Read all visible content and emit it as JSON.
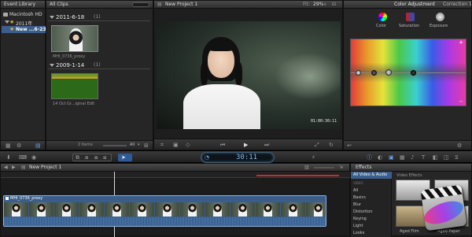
{
  "event_library": {
    "title": "Event Library",
    "items": [
      {
        "label": "Macintosh HD"
      },
      {
        "label": "2011年"
      },
      {
        "label": "New ...6-23"
      }
    ],
    "footer_count": ""
  },
  "browser": {
    "title": "All Clips",
    "groups": [
      {
        "date": "2011-6-18",
        "count": "(1)",
        "clips": [
          {
            "name": "MHI_0736_proxy"
          }
        ]
      },
      {
        "date": "2009-1-14",
        "count": "(1)",
        "clips": [
          {
            "name": "14 Oct Gr...iginal Edit"
          }
        ]
      }
    ],
    "footer_items": "2 items",
    "footer_all": "All"
  },
  "viewer": {
    "title": "New Project 1",
    "fit_label": "Fit:",
    "fit_value": "29%",
    "timecode_overlay": "01:00:30:11"
  },
  "inspector": {
    "title": "Color Adjustment",
    "correction": "Correction 1",
    "tabs": [
      {
        "label": "Color"
      },
      {
        "label": "Saturation"
      },
      {
        "label": "Exposure"
      }
    ]
  },
  "toolbar": {
    "timecode": "30:11"
  },
  "timeline": {
    "title": "New Project 1",
    "clip_name": "MHI_0736_proxy"
  },
  "effects": {
    "title": "Effects",
    "category_header": "All Video & Audio",
    "section_label": "VIDEO",
    "categories": [
      "All",
      "Basics",
      "Blur",
      "Distortion",
      "Keying",
      "Light",
      "Looks"
    ],
    "grid_header": "Video Effects",
    "thumbs": [
      {
        "label": "Aged Film"
      },
      {
        "label": "Aged Paper"
      }
    ]
  },
  "colors": {
    "accent_blue": "#2f6fd6",
    "timeline_blue": "#3a5d8a",
    "range_red": "#c03030",
    "film_green": "#3f8a2a"
  }
}
